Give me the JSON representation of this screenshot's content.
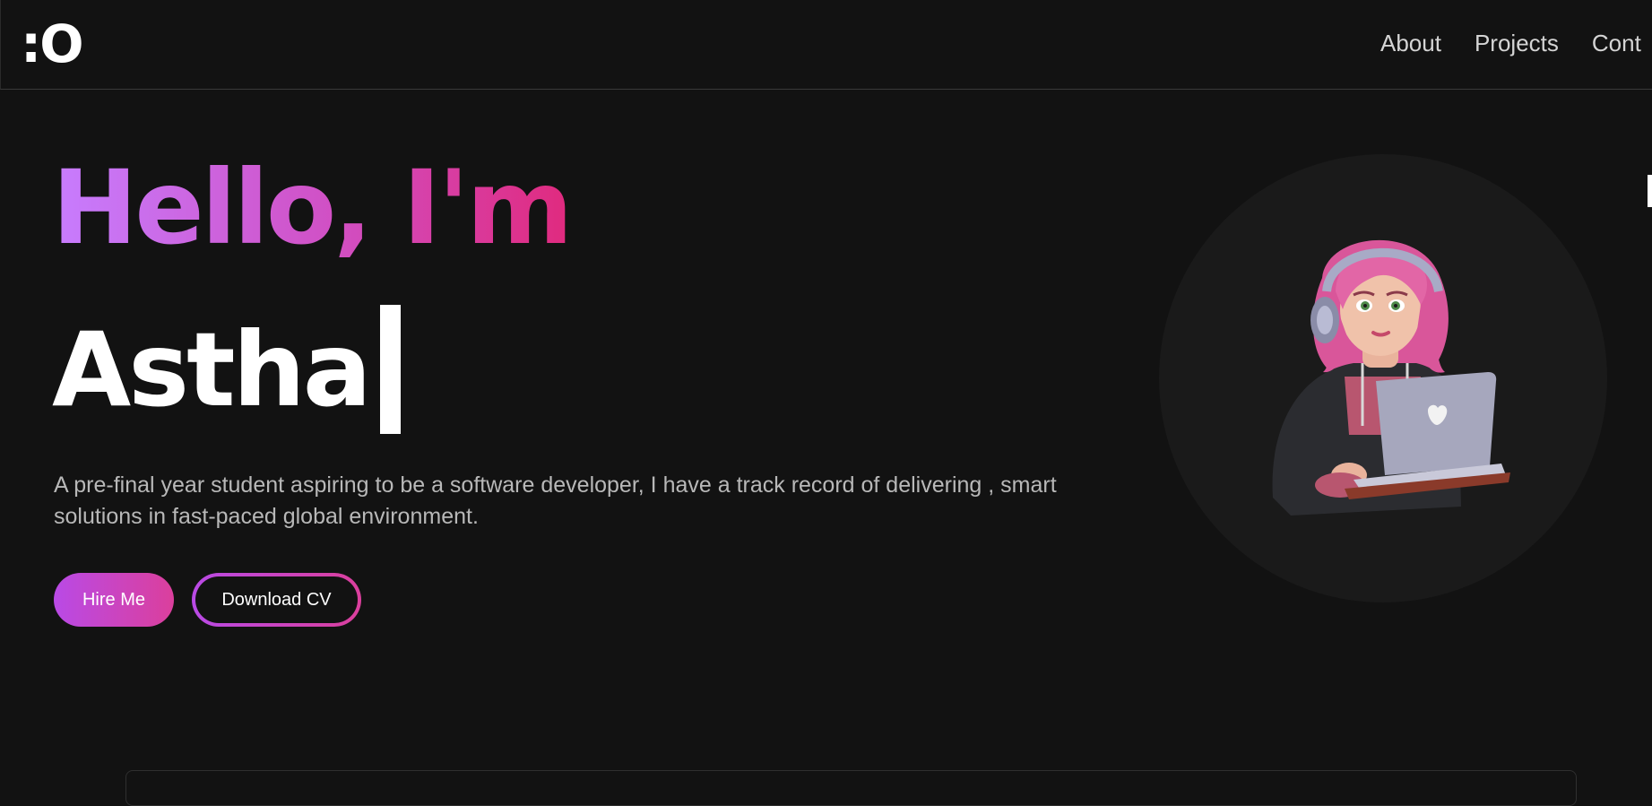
{
  "header": {
    "logo_text": ":O",
    "nav": [
      "About",
      "Projects",
      "Cont"
    ]
  },
  "hero": {
    "greeting": "Hello, I'm",
    "name": "Astha",
    "description": "A pre-final year student aspiring to be a software developer, I have a track record of delivering , smart solutions in fast-paced global environment.",
    "hire_button": "Hire Me",
    "cv_button": "Download CV"
  },
  "colors": {
    "background": "#121212",
    "gradient_start": "#c77dff",
    "gradient_end": "#e02a7e",
    "text_muted": "#b8b8b8"
  },
  "icons": {
    "avatar": "girl-with-laptop-avatar"
  }
}
